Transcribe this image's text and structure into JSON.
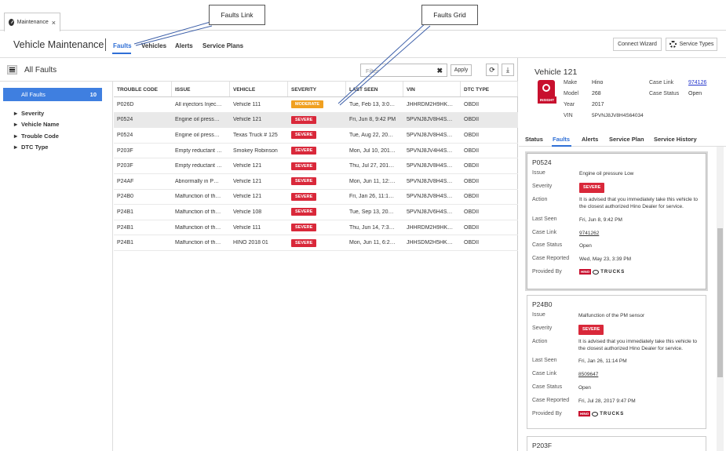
{
  "browser_tab": {
    "label": "Maintenance",
    "close": "×",
    "icon": "gauge-icon"
  },
  "header": {
    "title": "Vehicle Maintenance",
    "nav": [
      "Faults",
      "Vehicles",
      "Alerts",
      "Service Plans"
    ],
    "active_nav": "Faults",
    "connect_wizard": "Connect Wizard",
    "service_types": "Service Types"
  },
  "toolbar": {
    "title": "All Faults",
    "filter_placeholder": "Filter",
    "apply": "Apply"
  },
  "facets": {
    "all_label": "All Faults",
    "all_count": "10",
    "groups": [
      "Severity",
      "Vehicle Name",
      "Trouble Code",
      "DTC Type"
    ]
  },
  "grid": {
    "columns": [
      "TROUBLE CODE",
      "ISSUE",
      "VEHICLE",
      "SEVERITY",
      "LAST SEEN",
      "VIN",
      "DTC TYPE"
    ],
    "rows": [
      [
        "P026D",
        "All injectors Injec…",
        "Vehicle 111",
        "MODERATE",
        "Tue, Feb 13, 3:0…",
        "JHHRDM2H9HK…",
        "OBDII"
      ],
      [
        "P0524",
        "Engine oil press…",
        "Vehicle 121",
        "SEVERE",
        "Fri, Jun 8, 9:42 PM",
        "5PVNJ8JV8H4S…",
        "OBDII"
      ],
      [
        "P0524",
        "Engine oil press…",
        "Texas Truck # 125",
        "SEVERE",
        "Tue, Aug 22, 20…",
        "5PVNJ8JV8H4S…",
        "OBDII"
      ],
      [
        "P203F",
        "Empty reductant …",
        "Smokey Robinson",
        "SEVERE",
        "Mon, Jul 10, 201…",
        "5PVNJ8JV4H4S…",
        "OBDII"
      ],
      [
        "P203F",
        "Empty reductant …",
        "Vehicle 121",
        "SEVERE",
        "Thu, Jul 27, 201…",
        "5PVNJ8JV8H4S…",
        "OBDII"
      ],
      [
        "P24AF",
        "Abnormally in P…",
        "Vehicle 121",
        "SEVERE",
        "Mon, Jun 11, 12:…",
        "5PVNJ8JV8H4S…",
        "OBDII"
      ],
      [
        "P24B0",
        "Malfunction of th…",
        "Vehicle 121",
        "SEVERE",
        "Fri, Jan 26, 11:1…",
        "5PVNJ8JV8H4S…",
        "OBDII"
      ],
      [
        "P24B1",
        "Malfunction of th…",
        "Vehicle 108",
        "SEVERE",
        "Tue, Sep 13, 20…",
        "5PVNJ8JV6H4S…",
        "OBDII"
      ],
      [
        "P24B1",
        "Malfunction of th…",
        "Vehicle 111",
        "SEVERE",
        "Thu, Jun 14, 7:3…",
        "JHHRDM2H9HK…",
        "OBDII"
      ],
      [
        "P24B1",
        "Malfunction of th…",
        "HINO 2018 01",
        "SEVERE",
        "Mon, Jun 11, 6:2…",
        "JHHSDM2H5HK…",
        "OBDII"
      ]
    ],
    "selected_row": 1
  },
  "colors": {
    "accent": "#2f6fd6",
    "severe": "#d9283a",
    "moderate": "#f0a020",
    "selected_facet": "#3f7fe0",
    "brand": "#c8102e"
  },
  "vehicle": {
    "title": "Vehicle 121",
    "logo_text": "INSIGHT",
    "make_label": "Make",
    "make": "Hino",
    "model_label": "Model",
    "model": "268",
    "year_label": "Year",
    "year": "2017",
    "vin_label": "VIN",
    "vin": "5PVNJ8JV8H4S64034",
    "case_link_label": "Case Link",
    "case_link": "974126",
    "case_status_label": "Case Status",
    "case_status": "Open"
  },
  "detail_tabs": [
    "Status",
    "Faults",
    "Alerts",
    "Service Plan",
    "Service History"
  ],
  "active_detail_tab": "Faults",
  "labels": {
    "issue": "Issue",
    "severity": "Severity",
    "action": "Action",
    "last_seen": "Last Seen",
    "case_link": "Case Link",
    "case_status": "Case Status",
    "case_reported": "Case Reported",
    "provided_by": "Provided By"
  },
  "provider": {
    "hino": "HINO",
    "trucks": "TRUCKS"
  },
  "cards": [
    {
      "code": "P0524",
      "issue": "Engine oil pressure Low",
      "severity": "SEVERE",
      "action": "It is advised that you immediately take this vehicle to the closest authorized Hino Dealer for service.",
      "last_seen": "Fri, Jun 8, 9:42 PM",
      "case_link": "9741262",
      "case_status": "Open",
      "case_reported": "Wed, May 23, 3:39 PM"
    },
    {
      "code": "P24B0",
      "issue": "Malfunction of the PM sensor",
      "severity": "SEVERE",
      "action": "It is advised that you immediately take this vehicle to the closest authorized Hino Dealer for service.",
      "last_seen": "Fri, Jan 26, 11:14 PM",
      "case_link": "8509647",
      "case_status": "Open",
      "case_reported": "Fri, Jul 28, 2017 9:47 PM"
    },
    {
      "code": "P203F"
    }
  ],
  "annotations": {
    "faults_link": "Faults Link",
    "faults_grid": "Faults Grid"
  }
}
